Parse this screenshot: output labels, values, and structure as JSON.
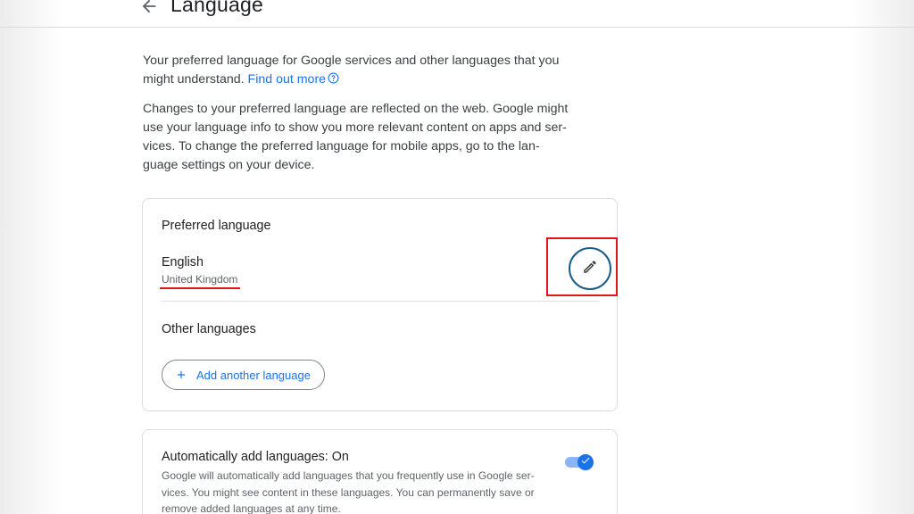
{
  "header": {
    "title": "Language",
    "back_icon": "arrow-left-icon"
  },
  "intro": {
    "text": "Your preferred language for Google services and other languages that you might understand.",
    "link_label": "Find out more",
    "help_icon": "help-circle-icon"
  },
  "intro2": {
    "text": "Changes to your preferred language are reflected on the web. Google might use your language info to show you more relevant content on apps and ser-vices. To change the preferred language for mobile apps, go to the lan-guage settings on your device."
  },
  "preferred": {
    "title": "Preferred language",
    "language": "English",
    "region": "United Kingdom",
    "edit_icon": "pencil-icon"
  },
  "other": {
    "title": "Other languages",
    "add_label": "Add another language",
    "add_icon": "plus-icon"
  },
  "auto": {
    "title": "Automatically add languages: On",
    "description": "Google will automatically add languages that you frequently use in Google ser-vices. You might see content in these languages. You can permanently save or remove added languages at any time.",
    "toggle_state": "on"
  },
  "colors": {
    "accent": "#1a73e8",
    "annotation_red": "#e3141b",
    "edit_ring": "#1a5c8a"
  }
}
